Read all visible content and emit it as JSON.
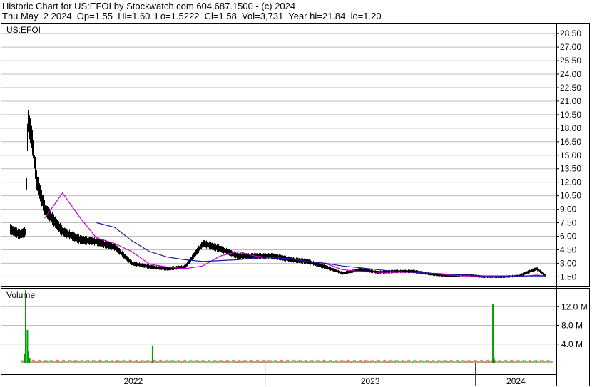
{
  "header": {
    "line1": "Historic Chart for US:EFOI by Stockwatch.com 604.687.1500 - (c) 2024",
    "line2": "Thu May  2 2024  Op=1.55  Hi=1.60  Lo=1.5222  Cl=1.58  Vol=3,731  Year hi=21.84  lo=1.20"
  },
  "colors": {
    "grid": "#bdbdbd",
    "price_bar": "#000000",
    "ma_short": "#cc00cc",
    "ma_long": "#1a1aa6",
    "vol_up": "#00a000",
    "vol_down": "#cc0000"
  },
  "chart_data": [
    {
      "type": "line",
      "symbol_label": "US:EFOI",
      "y_ticks": [
        "28.50",
        "27.00",
        "25.50",
        "24.00",
        "22.50",
        "21.00",
        "19.50",
        "18.00",
        "16.50",
        "15.00",
        "13.50",
        "12.00",
        "10.50",
        "9.00",
        "7.50",
        "6.00",
        "4.50",
        "3.00",
        "1.50"
      ],
      "ylim": [
        0.5,
        29.7
      ],
      "x_labels": [
        "2022",
        "2023",
        "2024"
      ],
      "x_dates": [
        "2021-10-15",
        "2021-11-01",
        "2021-11-12",
        "2021-11-15",
        "2021-11-22",
        "2021-12-01",
        "2021-12-15",
        "2022-01-15",
        "2022-02-15",
        "2022-03-15",
        "2022-04-15",
        "2022-05-15",
        "2022-06-15",
        "2022-07-15",
        "2022-08-15",
        "2022-09-15",
        "2022-10-15",
        "2022-11-15",
        "2022-12-15",
        "2023-01-15",
        "2023-02-15",
        "2023-03-15",
        "2023-04-15",
        "2023-05-15",
        "2023-06-15",
        "2023-07-15",
        "2023-08-15",
        "2023-09-15",
        "2023-10-15",
        "2023-11-15",
        "2023-12-15",
        "2024-01-15",
        "2024-02-15",
        "2024-03-15",
        "2024-04-15",
        "2024-05-02"
      ],
      "series": [
        {
          "role": "close",
          "values": [
            6.8,
            6.2,
            6.5,
            19.0,
            17.0,
            12.0,
            9.0,
            6.5,
            5.6,
            5.4,
            4.8,
            3.0,
            2.6,
            2.4,
            2.6,
            5.2,
            4.6,
            3.8,
            3.8,
            3.8,
            3.4,
            3.2,
            2.6,
            1.9,
            2.3,
            2.0,
            2.1,
            2.1,
            1.8,
            1.6,
            1.7,
            1.5,
            1.5,
            1.6,
            2.4,
            1.6
          ]
        },
        {
          "role": "ma_short",
          "values": [
            null,
            null,
            null,
            null,
            null,
            null,
            8.0,
            10.8,
            8.0,
            5.8,
            5.2,
            4.3,
            2.9,
            2.6,
            2.4,
            2.7,
            3.8,
            4.3,
            3.8,
            3.6,
            3.5,
            3.2,
            3.0,
            2.3,
            2.1,
            2.0,
            2.0,
            2.0,
            1.9,
            1.7,
            1.6,
            1.6,
            1.5,
            1.5,
            1.7,
            1.6
          ]
        },
        {
          "role": "ma_long",
          "values": [
            null,
            null,
            null,
            null,
            null,
            null,
            null,
            null,
            null,
            7.5,
            7.0,
            5.5,
            4.3,
            3.7,
            3.4,
            3.2,
            3.3,
            3.4,
            3.6,
            3.6,
            3.5,
            3.2,
            3.0,
            2.7,
            2.5,
            2.3,
            2.1,
            2.0,
            1.9,
            1.8,
            1.7,
            1.6,
            1.6,
            1.6,
            1.6,
            1.6
          ]
        }
      ]
    },
    {
      "type": "bar",
      "title": "Volume",
      "y_ticks": [
        "12.0 M",
        "8.0 M",
        "4.0 M"
      ],
      "ylim": [
        0,
        16
      ],
      "x_dates": [
        "2021-11-10",
        "2021-11-12",
        "2021-11-15",
        "2021-11-17",
        "2021-11-19",
        "2022-06-20",
        "2024-01-31",
        "2024-02-01",
        "2024-02-02"
      ],
      "values": [
        2.0,
        15.5,
        7.0,
        2.5,
        1.0,
        3.7,
        12.6,
        2.4,
        1.0
      ]
    }
  ]
}
